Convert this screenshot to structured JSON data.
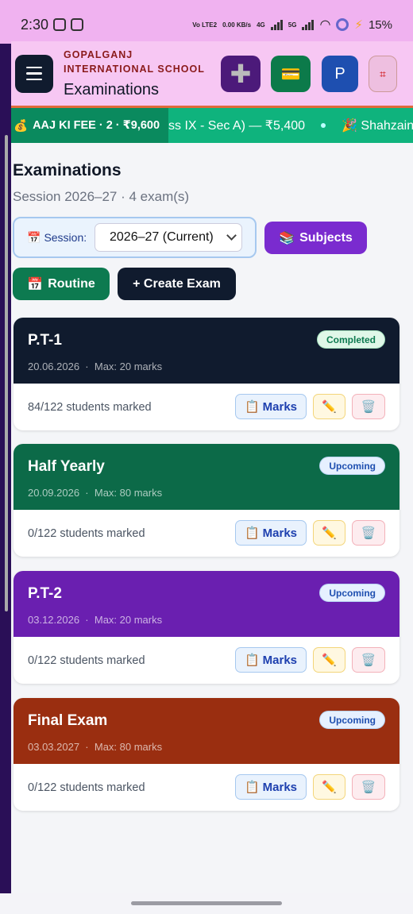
{
  "status_bar": {
    "time": "2:30",
    "network_top": "Vo LTE2",
    "speed": "0.00 KB/s",
    "net_4g": "4G",
    "net_5g": "5G",
    "battery": "15%"
  },
  "header": {
    "school_name": "GOPALGANJ INTERNATIONAL SCHOOL",
    "title": "Examinations",
    "buttons": [
      {
        "icon": "plus-icon",
        "glyph": "✚"
      },
      {
        "icon": "card-icon",
        "glyph": "💳"
      },
      {
        "icon": "profile-icon",
        "glyph": "P"
      },
      {
        "icon": "tag-icon",
        "glyph": "⌗"
      }
    ]
  },
  "ticker": {
    "label_emoji": "💰",
    "label": "AAJ KI FEE · 2 · ₹9,600",
    "items": [
      "ss IX - Sec A) — ₹5,400",
      "🎉 Shahzain ("
    ]
  },
  "page": {
    "heading": "Examinations",
    "subheading": "Session 2026–27 · 4 exam(s)"
  },
  "session": {
    "icon": "📅",
    "label": "Session:",
    "selected": "2026–27 (Current)"
  },
  "actions": {
    "subjects_icon": "📚",
    "subjects": "Subjects",
    "routine_icon": "📅",
    "routine": "Routine",
    "create": "+ Create Exam"
  },
  "exams": [
    {
      "name": "P.T-1",
      "date": "20.06.2026",
      "max": "Max: 20 marks",
      "status": "Completed",
      "marked": "84/122 students marked",
      "color": "#101b2e"
    },
    {
      "name": "Half Yearly",
      "date": "20.09.2026",
      "max": "Max: 80 marks",
      "status": "Upcoming",
      "marked": "0/122 students marked",
      "color": "#0c6a48"
    },
    {
      "name": "P.T-2",
      "date": "03.12.2026",
      "max": "Max: 20 marks",
      "status": "Upcoming",
      "marked": "0/122 students marked",
      "color": "#6a1fb0"
    },
    {
      "name": "Final Exam",
      "date": "03.03.2027",
      "max": "Max: 80 marks",
      "status": "Upcoming",
      "marked": "0/122 students marked",
      "color": "#9a2e10"
    }
  ],
  "card_buttons": {
    "marks_icon": "📋",
    "marks": "Marks",
    "edit_icon": "✏️",
    "delete_icon": "🗑️"
  }
}
